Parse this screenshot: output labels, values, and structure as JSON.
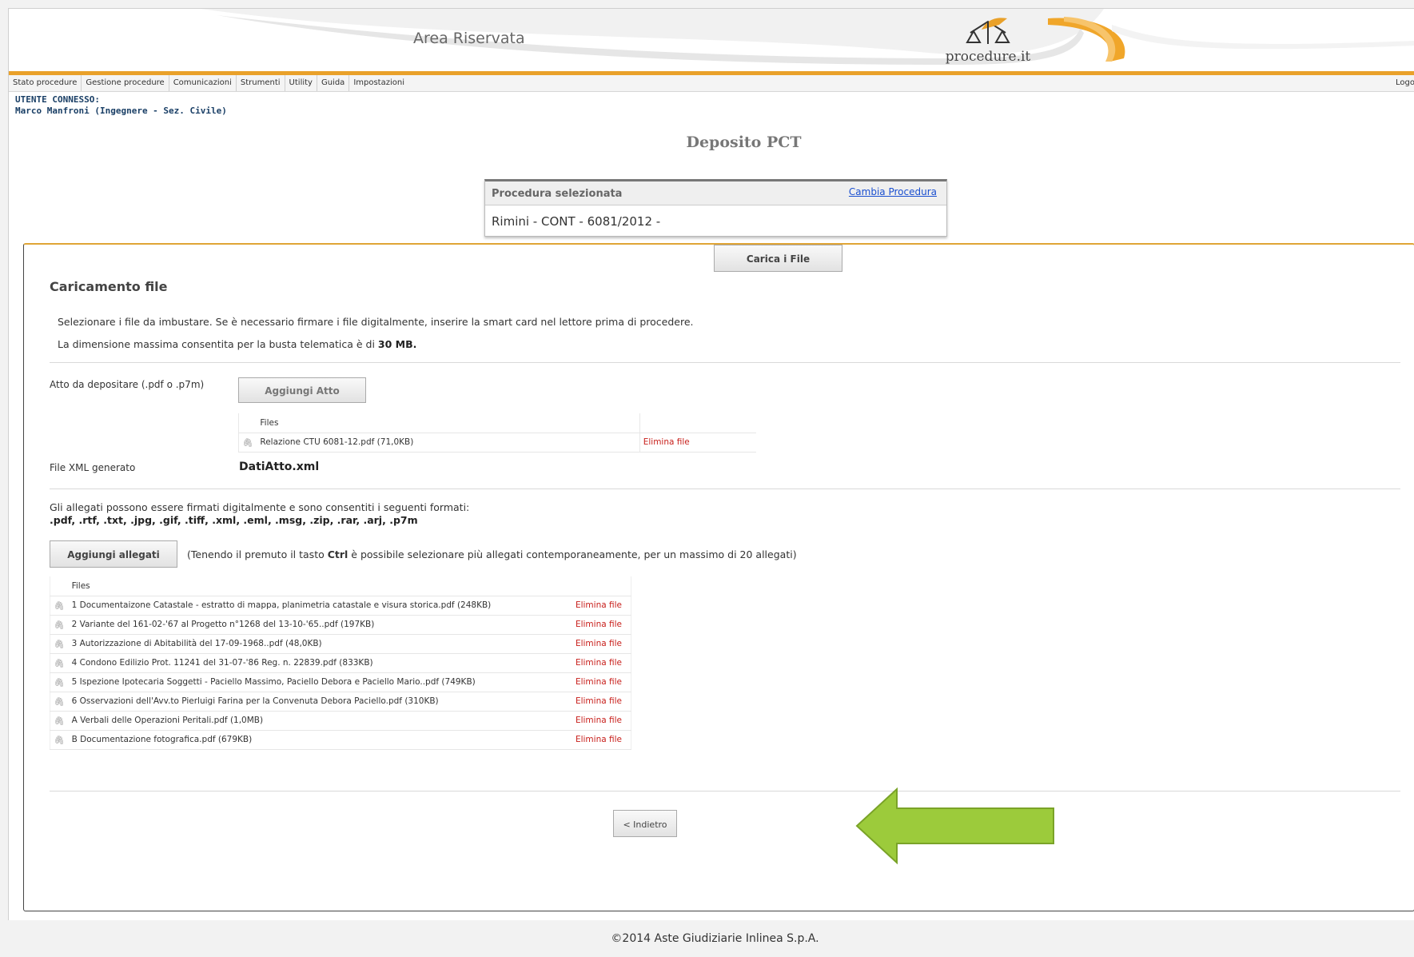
{
  "header": {
    "title": "Area Riservata",
    "logo_text": "procedure.it"
  },
  "menu": {
    "items": [
      "Stato procedure",
      "Gestione procedure",
      "Comunicazioni",
      "Strumenti",
      "Utility",
      "Guida",
      "Impostazioni"
    ],
    "logout": "Logo"
  },
  "user": {
    "label": "UTENTE CONNESSO:",
    "name": "Marco Manfroni (Ingegnere - Sez. Civile)"
  },
  "page": {
    "title": "Deposito PCT"
  },
  "procedure": {
    "label": "Procedura selezionata",
    "change_link": "Cambia Procedura",
    "value": "Rimini - CONT - 6081/2012 -"
  },
  "upload": {
    "section_title": "Caricamento file",
    "instructions": "Selezionare i file da imbustare. Se è necessario firmare i file digitalmente, inserire la smart card nel lettore prima di procedere.",
    "max_size_prefix": "La dimensione massima consentita per la busta telematica è di ",
    "max_size_value": "30 MB.",
    "atto_label": "Atto da depositare (.pdf o .p7m)",
    "add_atto_button": "Aggiungi Atto",
    "files_header": "Files",
    "atto_files": [
      {
        "name": "Relazione CTU 6081-12.pdf (71,0KB)",
        "action": "Elimina file"
      }
    ],
    "xml_label": "File XML generato",
    "xml_value": "DatiAtto.xml",
    "attachments_intro": "Gli allegati possono essere firmati digitalmente e sono consentiti i seguenti formati:",
    "attachments_formats": ".pdf, .rtf, .txt, .jpg, .gif, .tiff, .xml, .eml, .msg, .zip, .rar, .arj, .p7m",
    "add_attachments_button": "Aggiungi allegati",
    "note_prefix": "(Tenendo il premuto il tasto ",
    "note_key": "Ctrl",
    "note_suffix": " è possibile selezionare più allegati contemporaneamente, per un massimo di 20 allegati)",
    "attachments": [
      {
        "name": "1 Documentaizone Catastale - estratto di mappa, planimetria catastale e visura storica.pdf (248KB)",
        "action": "Elimina file"
      },
      {
        "name": "2 Variante del 161-02-'67 al Progetto n°1268 del 13-10-'65..pdf (197KB)",
        "action": "Elimina file"
      },
      {
        "name": "3 Autorizzazione di Abitabilità del 17-09-1968..pdf (48,0KB)",
        "action": "Elimina file"
      },
      {
        "name": "4 Condono Edilizio Prot. 11241 del 31-07-'86 Reg. n. 22839.pdf (833KB)",
        "action": "Elimina file"
      },
      {
        "name": "5 Ispezione Ipotecaria Soggetti - Paciello Massimo, Paciello Debora e Paciello Mario..pdf (749KB)",
        "action": "Elimina file"
      },
      {
        "name": "6 Osservazioni dell'Avv.to Pierluigi Farina per la Convenuta Debora Paciello.pdf (310KB)",
        "action": "Elimina file"
      },
      {
        "name": "A Verbali delle Operazioni Peritali.pdf (1,0MB)",
        "action": "Elimina file"
      },
      {
        "name": "B Documentazione fotografica.pdf (679KB)",
        "action": "Elimina file"
      }
    ],
    "back_button": "< Indietro",
    "upload_button": "Carica i File"
  },
  "footer": {
    "text": "©2014 Aste Giudiziarie Inlinea S.p.A."
  },
  "colors": {
    "accent_orange": "#e9a12a",
    "link_blue": "#1a4fd0",
    "delete_red": "#c8201c",
    "arrow_green": "#9ccb3b"
  }
}
